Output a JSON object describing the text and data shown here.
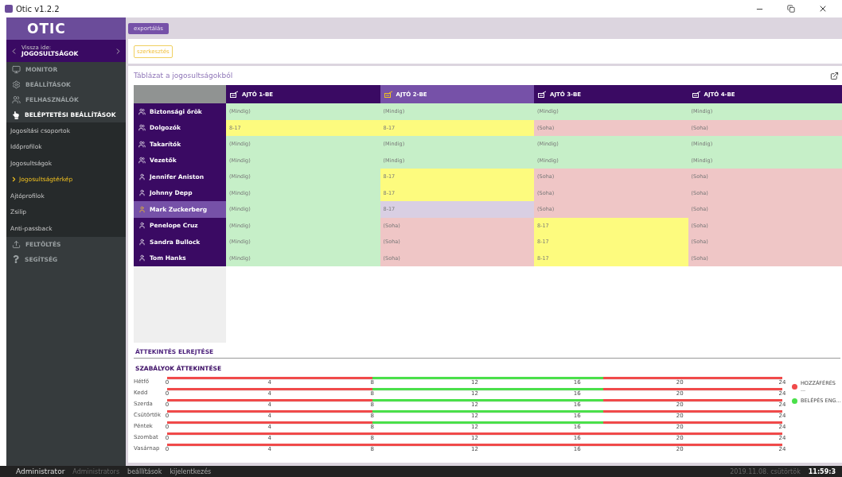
{
  "window": {
    "title": "Otic v1.2.2"
  },
  "sidebar": {
    "logo": "OTIC",
    "back": {
      "caption": "Vissza ide:",
      "target": "JOGOSULTSÁGOK"
    },
    "items": [
      {
        "label": "MONITOR",
        "kind": "monitor",
        "expanded": false
      },
      {
        "label": "BEÁLLÍTÁSOK",
        "kind": "gear",
        "expanded": false
      },
      {
        "label": "FELHASZNÁLÓK",
        "kind": "users",
        "expanded": false
      },
      {
        "label": "BELÉPTETÉSI BEÁLLÍTÁSOK",
        "kind": "hand",
        "expanded": true,
        "children": [
          {
            "label": "Jogosítási csoportok",
            "selected": false
          },
          {
            "label": "Időprofilok",
            "selected": false
          },
          {
            "label": "Jogosultságok",
            "selected": false
          },
          {
            "label": "Jogosultságtérkép",
            "selected": true
          },
          {
            "label": "Ajtóprofilok",
            "selected": false
          },
          {
            "label": "Zsilip",
            "selected": false
          },
          {
            "label": "Anti-passback",
            "selected": false
          }
        ]
      },
      {
        "label": "FELTÖLTÉS",
        "kind": "upload",
        "expanded": false
      },
      {
        "label": "SEGÍTSÉG",
        "kind": "question",
        "expanded": false
      }
    ]
  },
  "toolbar": {
    "export_button": "exportálás",
    "edit_button": "szerkesztés"
  },
  "table": {
    "title": "Táblázat a jogosultságokból",
    "columns": [
      {
        "label": "AJTÓ 1-BE",
        "selected": false
      },
      {
        "label": "AJTÓ 2-BE",
        "selected": true
      },
      {
        "label": "AJTÓ 3-BE",
        "selected": false
      },
      {
        "label": "AJTÓ 4-BE",
        "selected": false
      }
    ],
    "rows": [
      {
        "name": "Biztonsági őrök",
        "kind": "group",
        "selected": false,
        "cells": [
          {
            "value": "(Mindig)",
            "kind": "always"
          },
          {
            "value": "(Mindig)",
            "kind": "always"
          },
          {
            "value": "(Mindig)",
            "kind": "always"
          },
          {
            "value": "(Mindig)",
            "kind": "always"
          }
        ]
      },
      {
        "name": "Dolgozók",
        "kind": "group",
        "selected": false,
        "cells": [
          {
            "value": "8-17",
            "kind": "timed"
          },
          {
            "value": "8-17",
            "kind": "timed"
          },
          {
            "value": "(Soha)",
            "kind": "never"
          },
          {
            "value": "(Soha)",
            "kind": "never"
          }
        ]
      },
      {
        "name": "Takarítók",
        "kind": "group",
        "selected": false,
        "cells": [
          {
            "value": "(Mindig)",
            "kind": "always"
          },
          {
            "value": "(Mindig)",
            "kind": "always"
          },
          {
            "value": "(Mindig)",
            "kind": "always"
          },
          {
            "value": "(Mindig)",
            "kind": "always"
          }
        ]
      },
      {
        "name": "Vezetők",
        "kind": "group",
        "selected": false,
        "cells": [
          {
            "value": "(Mindig)",
            "kind": "always"
          },
          {
            "value": "(Mindig)",
            "kind": "always"
          },
          {
            "value": "(Mindig)",
            "kind": "always"
          },
          {
            "value": "(Mindig)",
            "kind": "always"
          }
        ]
      },
      {
        "name": "Jennifer Aniston",
        "kind": "person",
        "selected": false,
        "cells": [
          {
            "value": "(Mindig)",
            "kind": "always"
          },
          {
            "value": "8-17",
            "kind": "timed"
          },
          {
            "value": "(Soha)",
            "kind": "never"
          },
          {
            "value": "(Soha)",
            "kind": "never"
          }
        ]
      },
      {
        "name": "Johnny Depp",
        "kind": "person",
        "selected": false,
        "cells": [
          {
            "value": "(Mindig)",
            "kind": "always"
          },
          {
            "value": "8-17",
            "kind": "timed"
          },
          {
            "value": "(Soha)",
            "kind": "never"
          },
          {
            "value": "(Soha)",
            "kind": "never"
          }
        ]
      },
      {
        "name": "Mark Zuckerberg",
        "kind": "person",
        "selected": true,
        "cells": [
          {
            "value": "(Mindig)",
            "kind": "always"
          },
          {
            "value": "8-17",
            "kind": "timed"
          },
          {
            "value": "(Soha)",
            "kind": "never"
          },
          {
            "value": "(Soha)",
            "kind": "never"
          }
        ]
      },
      {
        "name": "Penelope Cruz",
        "kind": "person",
        "selected": false,
        "cells": [
          {
            "value": "(Mindig)",
            "kind": "always"
          },
          {
            "value": "(Soha)",
            "kind": "never"
          },
          {
            "value": "8-17",
            "kind": "timed"
          },
          {
            "value": "(Soha)",
            "kind": "never"
          }
        ]
      },
      {
        "name": "Sandra Bullock",
        "kind": "person",
        "selected": false,
        "cells": [
          {
            "value": "(Mindig)",
            "kind": "always"
          },
          {
            "value": "(Soha)",
            "kind": "never"
          },
          {
            "value": "8-17",
            "kind": "timed"
          },
          {
            "value": "(Soha)",
            "kind": "never"
          }
        ]
      },
      {
        "name": "Tom Hanks",
        "kind": "person",
        "selected": false,
        "cells": [
          {
            "value": "(Mindig)",
            "kind": "always"
          },
          {
            "value": "(Soha)",
            "kind": "never"
          },
          {
            "value": "8-17",
            "kind": "timed"
          },
          {
            "value": "(Soha)",
            "kind": "never"
          }
        ]
      }
    ]
  },
  "overview": {
    "hide_link": "ÁTTEKINTÉS ELREJTÉSE",
    "title": "SZABÁLYOK ÁTTEKINTÉSE",
    "days": [
      {
        "label": "Hétfő",
        "ticks": [
          "0",
          "4",
          "8",
          "12",
          "16",
          "20",
          "24"
        ],
        "segments": [
          {
            "kind": "denied",
            "level": 0.3333
          },
          {
            "kind": "allowed",
            "level": 0.7083
          },
          {
            "kind": "denied",
            "level": 1
          }
        ]
      },
      {
        "label": "Kedd",
        "ticks": [
          "0",
          "4",
          "8",
          "12",
          "16",
          "20",
          "24"
        ],
        "segments": [
          {
            "kind": "denied",
            "level": 0.3333
          },
          {
            "kind": "allowed",
            "level": 0.7083
          },
          {
            "kind": "denied",
            "level": 1
          }
        ]
      },
      {
        "label": "Szerda",
        "ticks": [
          "0",
          "4",
          "8",
          "12",
          "16",
          "20",
          "24"
        ],
        "segments": [
          {
            "kind": "denied",
            "level": 0.3333
          },
          {
            "kind": "allowed",
            "level": 0.7083
          },
          {
            "kind": "denied",
            "level": 1
          }
        ]
      },
      {
        "label": "Csütörtök",
        "ticks": [
          "0",
          "4",
          "8",
          "12",
          "16",
          "20",
          "24"
        ],
        "segments": [
          {
            "kind": "denied",
            "level": 0.3333
          },
          {
            "kind": "allowed",
            "level": 0.7083
          },
          {
            "kind": "denied",
            "level": 1
          }
        ]
      },
      {
        "label": "Péntek",
        "ticks": [
          "0",
          "4",
          "8",
          "12",
          "16",
          "20",
          "24"
        ],
        "segments": [
          {
            "kind": "denied",
            "level": 0.3333
          },
          {
            "kind": "allowed",
            "level": 0.7083
          },
          {
            "kind": "denied",
            "level": 1
          }
        ]
      },
      {
        "label": "Szombat",
        "ticks": [
          "0",
          "4",
          "8",
          "12",
          "16",
          "20",
          "24"
        ],
        "segments": [
          {
            "kind": "denied",
            "level": 1
          }
        ]
      },
      {
        "label": "Vasárnap",
        "ticks": [
          "0",
          "4",
          "8",
          "12",
          "16",
          "20",
          "24"
        ],
        "segments": [
          {
            "kind": "denied",
            "level": 1
          }
        ]
      }
    ],
    "legend": [
      {
        "label": "HOZZÁFÉRÉS ...",
        "color": "#f04a4a"
      },
      {
        "label": "BELÉPÉS ENG...",
        "color": "#4ae04a"
      }
    ]
  },
  "status_bar": {
    "user": "Administrator",
    "role": "Administrators",
    "links": [
      "beállítások",
      "kijelentkezés"
    ],
    "date": "2019.11.08. csütörtök",
    "time": "11:59:3"
  }
}
